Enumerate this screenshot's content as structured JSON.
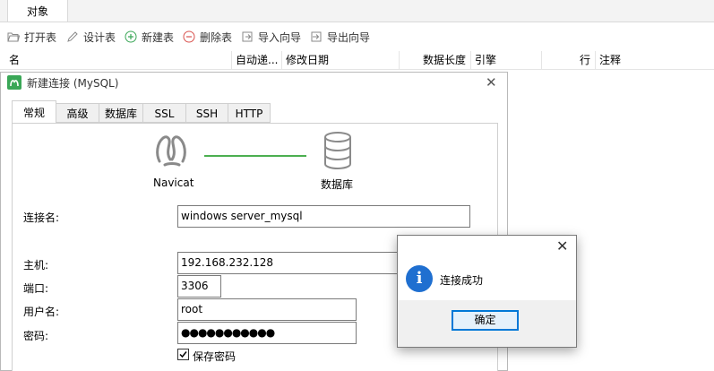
{
  "top_tab": {
    "label": "对象"
  },
  "toolbar": {
    "open_table": "打开表",
    "design_table": "设计表",
    "new_table": "新建表",
    "delete_table": "删除表",
    "import_wizard": "导入向导",
    "export_wizard": "导出向导"
  },
  "columns": {
    "name": "名",
    "auto_increment": "自动递...",
    "modified_date": "修改日期",
    "data_length": "数据长度",
    "engine": "引擎",
    "rows": "行",
    "comment": "注释"
  },
  "dialog": {
    "title": "新建连接 (MySQL)",
    "close": "✕",
    "tabs": [
      "常规",
      "高级",
      "数据库",
      "SSL",
      "SSH",
      "HTTP"
    ],
    "diagram": {
      "left_label": "Navicat",
      "right_label": "数据库"
    },
    "fields": {
      "connection_name_label": "连接名:",
      "connection_name_value": "windows server_mysql",
      "host_label": "主机:",
      "host_value": "192.168.232.128",
      "port_label": "端口:",
      "port_value": "3306",
      "username_label": "用户名:",
      "username_value": "root",
      "password_label": "密码:",
      "password_value": "●●●●●●●●●●●",
      "save_password_label": "保存密码",
      "save_password_checked": true
    }
  },
  "message_box": {
    "close": "✕",
    "icon": "i",
    "text": "连接成功",
    "ok_label": "确定"
  },
  "colors": {
    "accent": "#0078d7",
    "info_icon": "#1f6fd0",
    "connector_line": "#4caf50",
    "toolbar_icon_green": "#3aa757",
    "toolbar_icon_red": "#d9534f"
  }
}
